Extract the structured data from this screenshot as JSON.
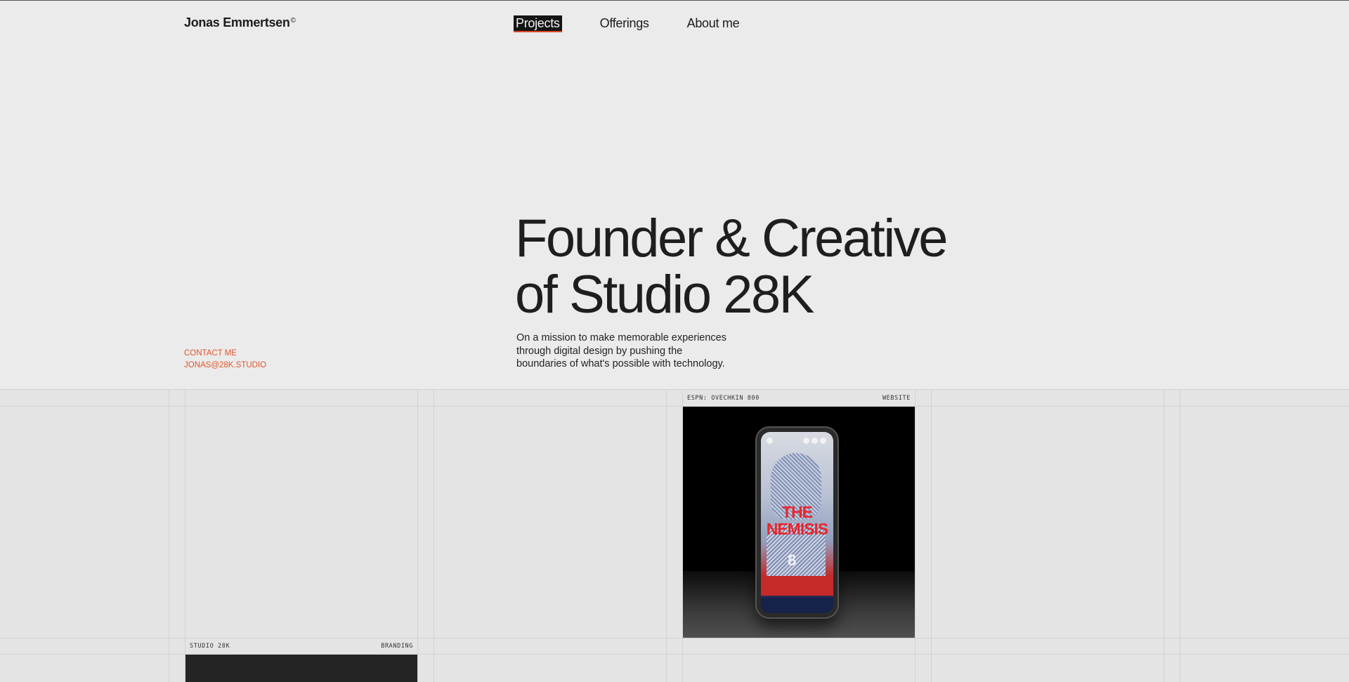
{
  "header": {
    "brand": "Jonas Emmertsen",
    "brand_mark": "©",
    "nav": [
      {
        "label": "Projects",
        "active": true
      },
      {
        "label": "Offerings",
        "active": false
      },
      {
        "label": "About me",
        "active": false
      }
    ]
  },
  "hero": {
    "title_line1": "Founder & Creative",
    "title_line2": "of Studio 28K",
    "subtitle_line1": "On a mission to make memorable experiences",
    "subtitle_line2": "through digital design by pushing the",
    "subtitle_line3": "boundaries of what's possible with technology."
  },
  "contact": {
    "label": "CONTACT ME",
    "email": "JONAS@28K.STUDIO"
  },
  "projects": [
    {
      "name": "ESPN: OVECHKIN 800",
      "category": "WEBSITE",
      "screen_title_1": "THE",
      "screen_title_2": "NEMISIS",
      "screen_number": "8"
    },
    {
      "name": "STUDIO 28K",
      "category": "BRANDING"
    }
  ],
  "colors": {
    "background": "#ebebeb",
    "accent": "#e0542a",
    "text": "#1c1c1c"
  }
}
